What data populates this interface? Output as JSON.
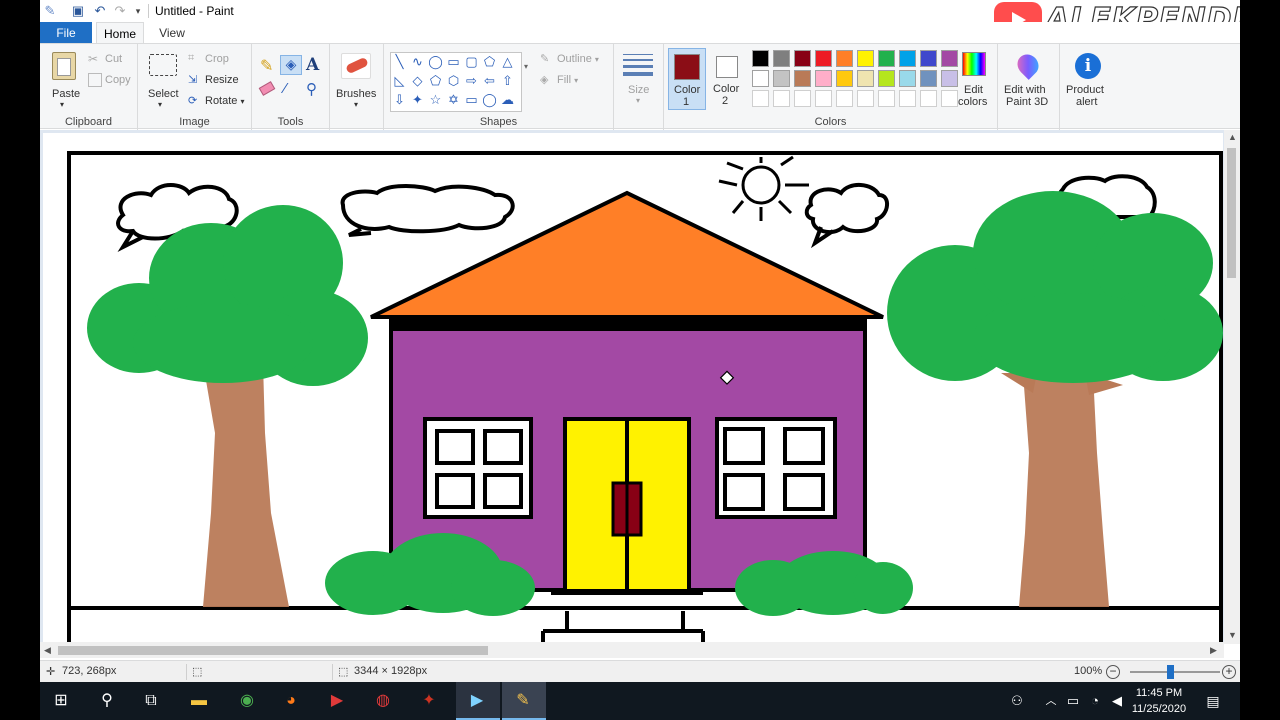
{
  "window": {
    "title": "Untitled - Paint",
    "watermark": "ALEKPENDI"
  },
  "menu": {
    "tabs": [
      "File",
      "Home",
      "View"
    ]
  },
  "ribbon": {
    "clipboard": {
      "label": "Clipboard",
      "paste": "Paste",
      "cut": "Cut",
      "copy": "Copy"
    },
    "image": {
      "label": "Image",
      "select": "Select",
      "crop": "Crop",
      "resize": "Resize",
      "rotate": "Rotate"
    },
    "tools": {
      "label": "Tools"
    },
    "brushes": {
      "label": "Brushes"
    },
    "shapes": {
      "label": "Shapes",
      "outline": "Outline",
      "fill": "Fill"
    },
    "size": {
      "label": "Size"
    },
    "colors": {
      "label": "Colors",
      "color1": "Color",
      "color1_num": "1",
      "color2": "Color",
      "color2_num": "2",
      "edit_colors_1": "Edit",
      "edit_colors_2": "colors",
      "color1_value": "#8b0d16",
      "color2_value": "#ffffff",
      "palette_row1": [
        "#000000",
        "#7f7f7f",
        "#880015",
        "#ed1c24",
        "#ff7f27",
        "#fff200",
        "#22b14c",
        "#00a2e8",
        "#3f48cc",
        "#a349a4"
      ],
      "palette_row2": [
        "#ffffff",
        "#c3c3c3",
        "#b97a57",
        "#ffaec9",
        "#ffc90e",
        "#efe4b0",
        "#b5e61d",
        "#99d9ea",
        "#7092be",
        "#c8bfe7"
      ]
    },
    "paint3d": {
      "line1": "Edit with",
      "line2": "Paint 3D"
    },
    "alert": {
      "line1": "Product",
      "line2": "alert"
    }
  },
  "status": {
    "cursor_pos": "723, 268px",
    "canvas_size": "3344 × 1928px",
    "zoom": "100%",
    "zoom_level_fraction": 0.5
  },
  "taskbar": {
    "time": "11:45 PM",
    "date": "11/25/2020"
  }
}
